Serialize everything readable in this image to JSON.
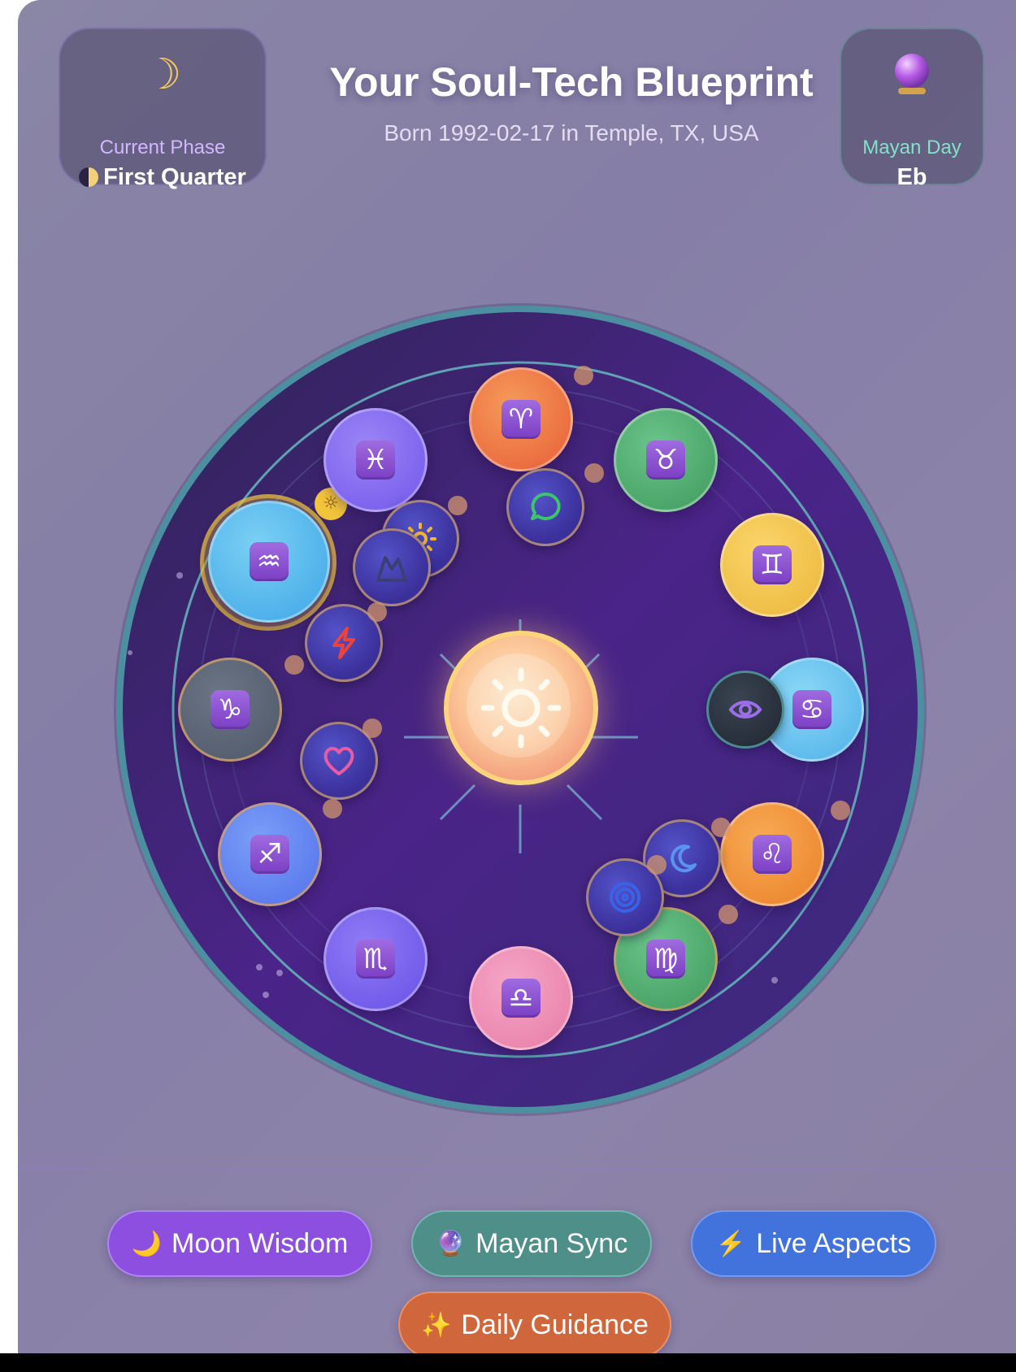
{
  "header": {
    "title": "Your Soul-Tech Blueprint",
    "subtitle": "Born 1992-02-17 in Temple, TX, USA"
  },
  "phase_card": {
    "icon": "crescent-moon-icon",
    "label": "Current Phase",
    "value": "First Quarter"
  },
  "mayan_card": {
    "icon": "crystal-ball-icon",
    "label": "Mayan Day",
    "value": "Eb"
  },
  "wheel": {
    "center": "sun-icon",
    "signs": [
      {
        "name": "Aries",
        "glyph": "♈",
        "color": "#f0703e"
      },
      {
        "name": "Taurus",
        "glyph": "♉",
        "color": "#4caa6e"
      },
      {
        "name": "Gemini",
        "glyph": "♊",
        "color": "#f2c24a"
      },
      {
        "name": "Cancer",
        "glyph": "♋",
        "color": "#5fc0ee"
      },
      {
        "name": "Leo",
        "glyph": "♌",
        "color": "#f08e3a"
      },
      {
        "name": "Virgo",
        "glyph": "♍",
        "color": "#4caa6e"
      },
      {
        "name": "Libra",
        "glyph": "♎",
        "color": "#ef89b1"
      },
      {
        "name": "Scorpio",
        "glyph": "♏",
        "color": "#7a63f2"
      },
      {
        "name": "Sagittarius",
        "glyph": "♐",
        "color": "#5f84f2"
      },
      {
        "name": "Capricorn",
        "glyph": "♑",
        "color": "#5c6778"
      },
      {
        "name": "Aquarius",
        "glyph": "♒",
        "color": "#56b6ea"
      },
      {
        "name": "Pisces",
        "glyph": "♓",
        "color": "#8a6cf2"
      }
    ],
    "planets": [
      {
        "name": "chat-bubble-icon"
      },
      {
        "name": "sun-icon"
      },
      {
        "name": "mountain-icon"
      },
      {
        "name": "lightning-icon"
      },
      {
        "name": "heart-icon"
      },
      {
        "name": "eye-icon"
      },
      {
        "name": "moon-icon"
      },
      {
        "name": "spiral-target-icon"
      }
    ]
  },
  "buttons": {
    "moon": {
      "icon": "🌙",
      "label": "Moon Wisdom"
    },
    "mayan": {
      "icon": "🔮",
      "label": "Mayan Sync"
    },
    "live": {
      "icon": "⚡",
      "label": "Live Aspects"
    },
    "daily": {
      "icon": "✨",
      "label": "Daily Guidance"
    }
  }
}
